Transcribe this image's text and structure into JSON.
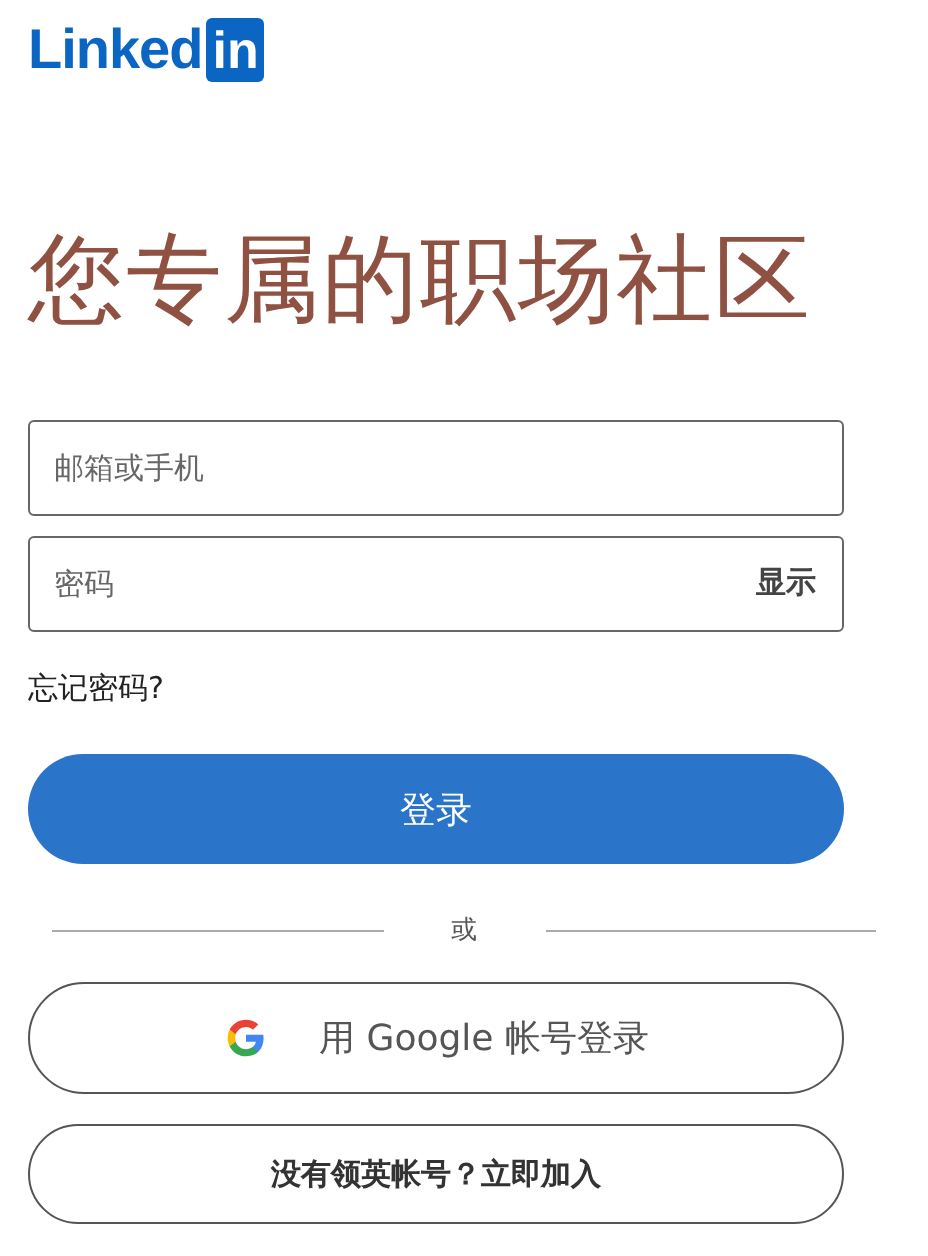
{
  "logo": {
    "text": "Linked",
    "badge": "in"
  },
  "heading": "您专属的职场社区",
  "email_field": {
    "placeholder": "邮箱或手机"
  },
  "password_field": {
    "placeholder": "密码",
    "toggle": "显示"
  },
  "forgot_link": "忘记密码?",
  "sign_in_button": "登录",
  "divider": "或",
  "google_button": "用 Google 帐号登录",
  "join_button": "没有领英帐号？立即加入"
}
